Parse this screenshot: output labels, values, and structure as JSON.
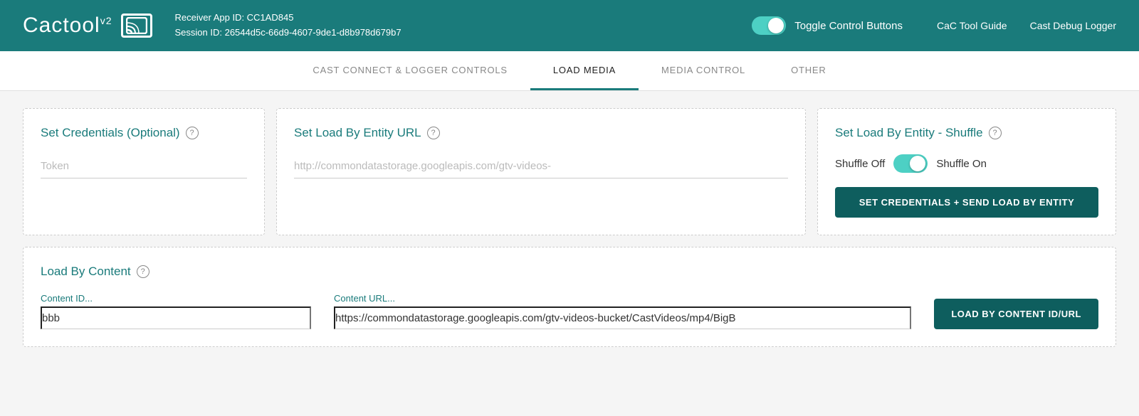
{
  "header": {
    "logo_text": "Cactool",
    "logo_version": "v2",
    "receiver_app_id_label": "Receiver App ID: CC1AD845",
    "session_id_label": "Session ID: 26544d5c-66d9-4607-9de1-d8b978d679b7",
    "toggle_label": "Toggle Control Buttons",
    "nav_links": [
      {
        "id": "cac-tool-guide",
        "label": "CaC Tool Guide"
      },
      {
        "id": "cast-debug-logger",
        "label": "Cast Debug Logger"
      }
    ]
  },
  "tabs": [
    {
      "id": "cast-connect",
      "label": "CAST CONNECT & LOGGER CONTROLS",
      "active": false
    },
    {
      "id": "load-media",
      "label": "LOAD MEDIA",
      "active": true
    },
    {
      "id": "media-control",
      "label": "MEDIA CONTROL",
      "active": false
    },
    {
      "id": "other",
      "label": "OTHER",
      "active": false
    }
  ],
  "cards": {
    "credentials": {
      "title": "Set Credentials (Optional)",
      "token_placeholder": "Token"
    },
    "entity_url": {
      "title": "Set Load By Entity URL",
      "url_placeholder": "http://commondatastorage.googleapis.com/gtv-videos-"
    },
    "shuffle": {
      "title": "Set Load By Entity - Shuffle",
      "shuffle_off_label": "Shuffle Off",
      "shuffle_on_label": "Shuffle On",
      "button_label": "SET CREDENTIALS + SEND LOAD BY ENTITY"
    },
    "load_content": {
      "title": "Load By Content",
      "content_id_label": "Content ID...",
      "content_id_value": "bbb",
      "content_url_label": "Content URL...",
      "content_url_value": "https://commondatastorage.googleapis.com/gtv-videos-bucket/CastVideos/mp4/BigB",
      "button_label": "LOAD BY CONTENT ID/URL"
    }
  },
  "icons": {
    "help": "?",
    "cast": "cast"
  },
  "colors": {
    "teal": "#1a7b7b",
    "teal_dark": "#0e5e5e",
    "teal_light": "#4dd0c4"
  }
}
